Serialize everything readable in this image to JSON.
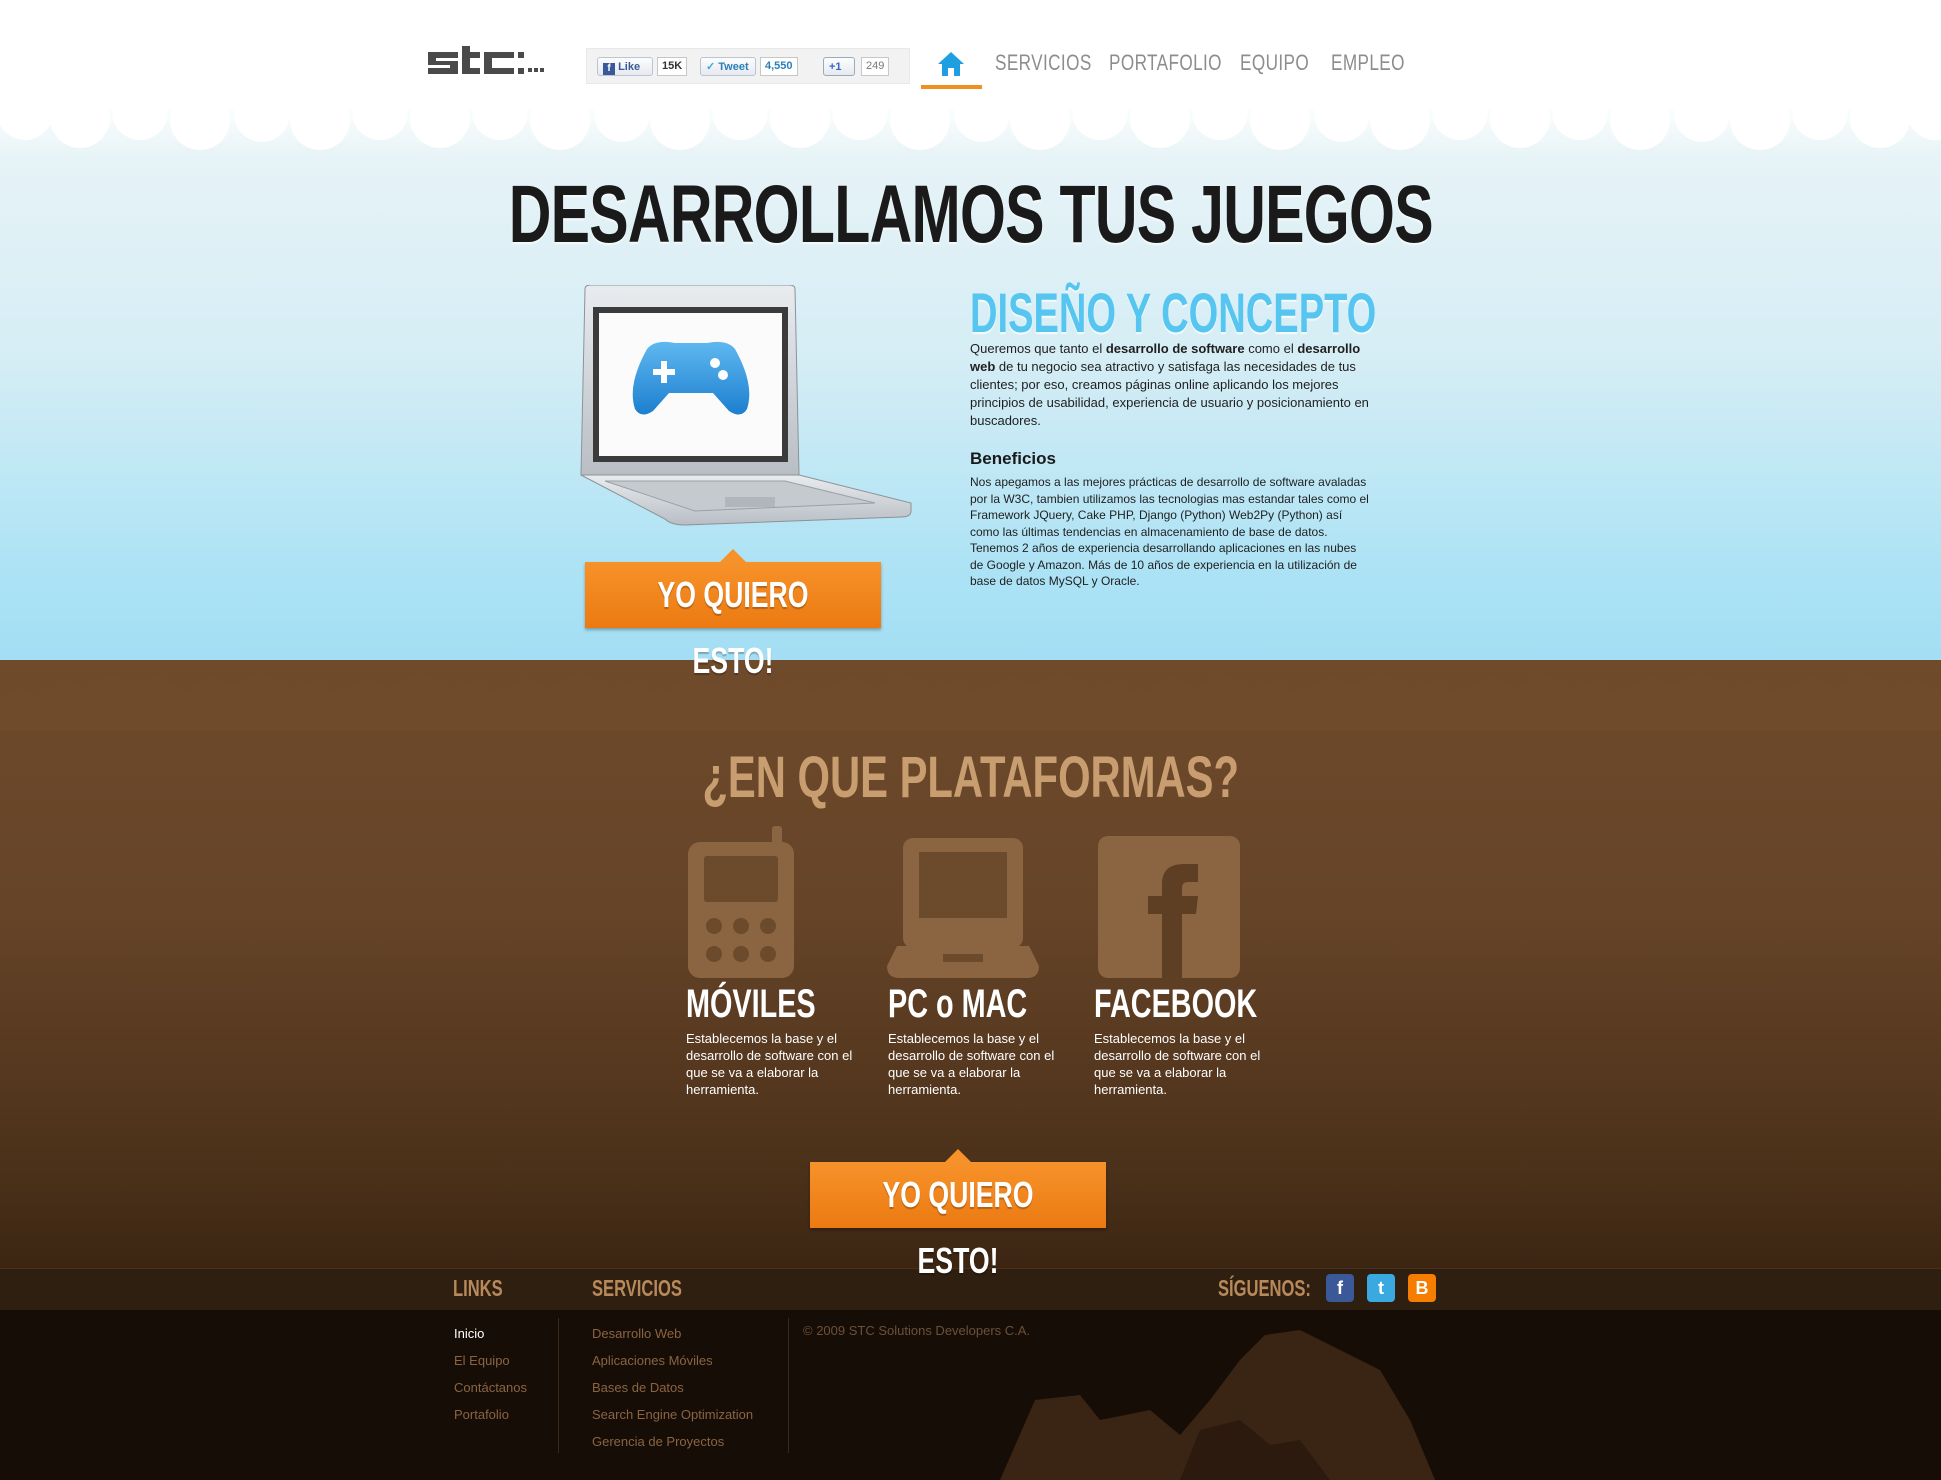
{
  "header": {
    "logo_text": "stc",
    "social": {
      "like_label": "Like",
      "like_count": "15K",
      "tweet_label": "Tweet",
      "tweet_count": "4,550",
      "plusone_label": "+1",
      "plusone_count": "249"
    },
    "nav": {
      "home_icon": "home-icon",
      "items": [
        {
          "label": "SERVICIOS"
        },
        {
          "label": "PORTAFOLIO"
        },
        {
          "label": "EQUIPO"
        },
        {
          "label": "EMPLEO"
        }
      ]
    }
  },
  "hero": {
    "headline": "DESARROLLAMOS TUS JUEGOS",
    "illustration_icon": "laptop-gamepad-icon",
    "section_title": "DISEÑO Y CONCEPTO",
    "intro": {
      "p1": "Queremos que tanto el ",
      "b1": "desarrollo de software",
      "p2": " como el ",
      "b2": "desarrollo web",
      "p3": " de tu negocio sea atractivo y satisfaga las necesidades de tus clientes; por eso, creamos páginas online aplicando los mejores principios de usabilidad, experiencia de usuario y posicionamiento en buscadores."
    },
    "benefits_title": "Beneficios",
    "benefits_text": "Nos apegamos a las mejores prácticas de desarrollo de software avaladas por la W3C, tambien utilizamos las tecnologias mas estandar tales como el Framework JQuery, Cake PHP, Django (Python) Web2Py (Python) así como las últimas tendencias en almacenamiento de base de datos. Tenemos 2 años de experiencia desarrollando aplicaciones en las nubes de Google y Amazon. Más de 10 años de experiencia en la utilización de base de datos MySQL y Oracle.",
    "cta_label": "YO QUIERO ESTO!"
  },
  "platforms": {
    "title": "¿EN QUE PLATAFORMAS?",
    "items": [
      {
        "icon": "mobile-phone-icon",
        "title": "MÓVILES",
        "text": "Establecemos la base y el desarrollo de software con el que se va a elaborar la herramienta."
      },
      {
        "icon": "laptop-icon",
        "title": "PC o MAC",
        "text": "Establecemos la base y el desarrollo de software con el que se va a elaborar la herramienta."
      },
      {
        "icon": "facebook-icon",
        "title": "FACEBOOK",
        "text": "Establecemos la base y el desarrollo de software con el que se va a elaborar la herramienta."
      }
    ],
    "cta_label": "YO QUIERO ESTO!"
  },
  "footer": {
    "links_title": "LINKS",
    "links": [
      "Inicio",
      "El Equipo",
      "Contáctanos",
      "Portafolio"
    ],
    "services_title": "SERVICIOS",
    "services": [
      "Desarrollo Web",
      "Aplicaciones Móviles",
      "Bases de Datos",
      "Search Engine Optimization",
      "Gerencia de Proyectos"
    ],
    "copyright": "© 2009 STC Solutions Developers C.A.",
    "follow_label": "SÍGUENOS:",
    "follow_icons": [
      "facebook-icon",
      "twitter-icon",
      "blogger-icon"
    ],
    "colors": {
      "facebook": "#3b5998",
      "twitter": "#39a9e0",
      "blogger": "#f57d00"
    }
  },
  "colors": {
    "accent_orange": "#f7922a",
    "accent_blue": "#56c6f1",
    "ground_brown": "#6f4a2b",
    "platform_title": "#c89e70"
  }
}
